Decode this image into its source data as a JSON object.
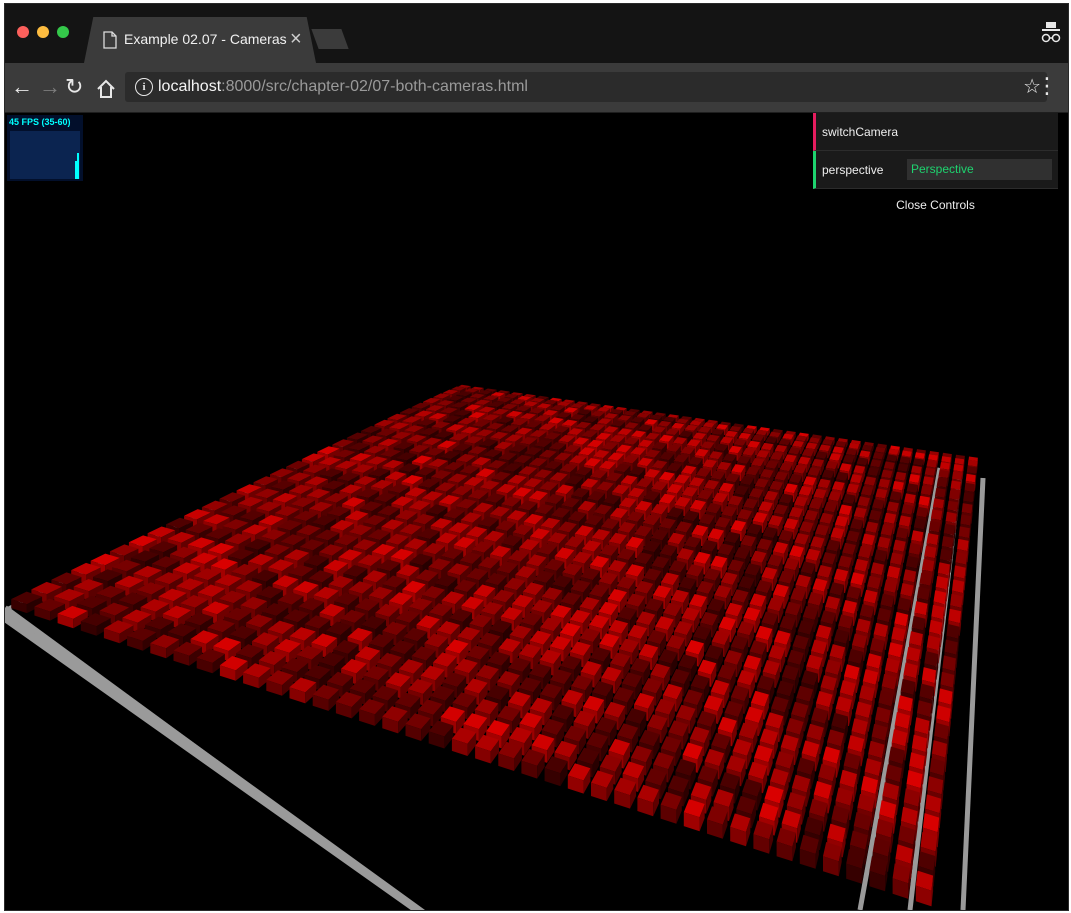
{
  "browser": {
    "tab_title": "Example 02.07 - Cameras",
    "tab_close": "×",
    "url_host": "localhost",
    "url_rest": ":8000/src/chapter-02/07-both-cameras.html"
  },
  "stats": {
    "text": "45 FPS (35-60)",
    "color": "#00ffff"
  },
  "gui": {
    "switch_label": "switchCamera",
    "perspective_label": "perspective",
    "perspective_value": "Perspective",
    "close_label": "Close Controls",
    "function_color": "#e61d5f",
    "string_color": "#1ed36f"
  },
  "scene": {
    "cube_color": "#b00000",
    "plane_color": "#9a9a9a",
    "background": "#000000"
  }
}
